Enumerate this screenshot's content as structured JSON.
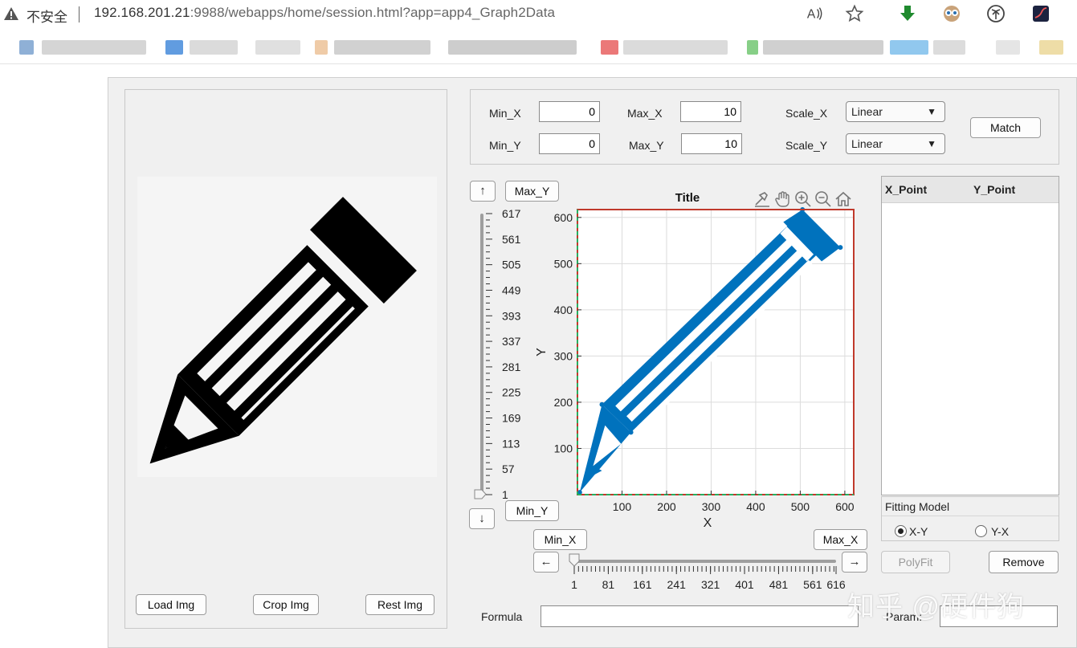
{
  "browser": {
    "insecure_label": "不安全",
    "url_host": "192.168.201.21",
    "url_rest": ":9988/webapps/home/session.html?app=app4_Graph2Data",
    "read_aloud": "A͡"
  },
  "left_panel": {
    "load_label": "Load Img",
    "crop_label": "Crop Img",
    "reset_label": "Rest Img"
  },
  "settings": {
    "min_x_label": "Min_X",
    "max_x_label": "Max_X",
    "min_y_label": "Min_Y",
    "max_y_label": "Max_Y",
    "min_x": "0",
    "max_x": "10",
    "min_y": "0",
    "max_y": "10",
    "scale_x_label": "Scale_X",
    "scale_y_label": "Scale_Y",
    "scale_x": "Linear",
    "scale_y": "Linear",
    "match_label": "Match"
  },
  "yslider": {
    "up_arrow": "↑",
    "down_arrow": "↓",
    "max_label": "Max_Y",
    "min_label": "Min_Y",
    "ticks": [
      "617",
      "561",
      "505",
      "449",
      "393",
      "337",
      "281",
      "225",
      "169",
      "113",
      "57",
      "1"
    ]
  },
  "xslider": {
    "left_arrow": "←",
    "right_arrow": "→",
    "min_label": "Min_X",
    "max_label": "Max_X",
    "ticks": [
      "1",
      "81",
      "161",
      "241",
      "321",
      "401",
      "481",
      "561",
      "616"
    ]
  },
  "chart_data": {
    "type": "scatter",
    "title": "Title",
    "xlabel": "X",
    "ylabel": "Y",
    "xlim": [
      0,
      620
    ],
    "ylim": [
      0,
      617
    ],
    "xticks": [
      100,
      200,
      300,
      400,
      500,
      600
    ],
    "yticks": [
      100,
      200,
      300,
      400,
      500,
      600
    ],
    "grid": true,
    "series_color": "#0072BD",
    "axis_box_color": "#C0392B",
    "y_axis_line_color": "#27AE60"
  },
  "table": {
    "col_x": "X_Point",
    "col_y": "Y_Point"
  },
  "fitting": {
    "title": "Fitting Model",
    "opt_xy": "X-Y",
    "opt_yx": "Y-X",
    "polyfit_label": "PolyFit",
    "remove_label": "Remove"
  },
  "formula": {
    "formula_label": "Formula",
    "param_label": "Param:"
  },
  "watermark": "知乎 @硬件狗"
}
